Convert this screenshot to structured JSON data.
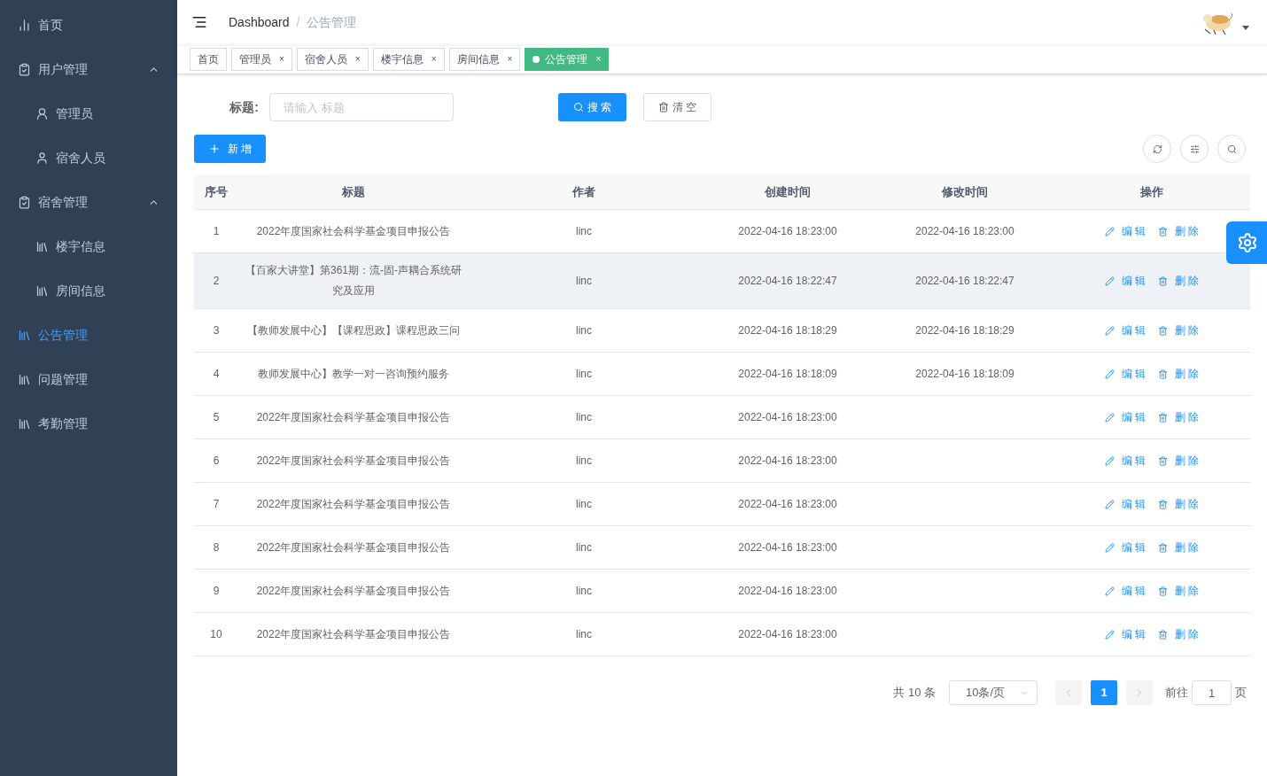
{
  "sidebar": {
    "items": [
      {
        "label": "首页",
        "kind": "chart",
        "selected": false
      },
      {
        "label": "用户管理",
        "kind": "clipboard",
        "selected": false,
        "expanded": true,
        "children": [
          {
            "label": "管理员",
            "kind": "user",
            "selected": false
          },
          {
            "label": "宿舍人员",
            "kind": "person",
            "selected": false
          }
        ]
      },
      {
        "label": "宿舍管理",
        "kind": "clipboard",
        "selected": false,
        "expanded": true,
        "children": [
          {
            "label": "楼宇信息",
            "kind": "book",
            "selected": false
          },
          {
            "label": "房间信息",
            "kind": "book",
            "selected": false
          }
        ]
      },
      {
        "label": "公告管理",
        "kind": "book",
        "selected": true
      },
      {
        "label": "问题管理",
        "kind": "book",
        "selected": false
      },
      {
        "label": "考勤管理",
        "kind": "book",
        "selected": false
      }
    ]
  },
  "breadcrumb": [
    "Dashboard",
    "公告管理"
  ],
  "breadcrumb_separator": "/",
  "tags": [
    {
      "label": "首页",
      "selected": false,
      "closable": false
    },
    {
      "label": "管理员",
      "selected": false,
      "closable": true
    },
    {
      "label": "宿舍人员",
      "selected": false,
      "closable": true
    },
    {
      "label": "楼宇信息",
      "selected": false,
      "closable": true
    },
    {
      "label": "房间信息",
      "selected": false,
      "closable": true
    },
    {
      "label": "公告管理",
      "selected": true,
      "closable": true
    }
  ],
  "tag_close": "×",
  "search": {
    "label": "标题:",
    "placeholder": "请输入 标题",
    "search_button": "搜 索",
    "clear_button": "清 空"
  },
  "add_button": "新 增",
  "table": {
    "columns": [
      "序号",
      "标题",
      "作者",
      "创建时间",
      "修改时间",
      "操作"
    ],
    "rows": [
      {
        "cells": [
          "1",
          "2022年度国家社会科学基金项目申报公告",
          "linc",
          "2022-04-16 18:23:00",
          "2022-04-16 18:23:00"
        ],
        "edit": "编 辑",
        "delete": "删 除",
        "highlighted": false
      },
      {
        "cells": [
          "2",
          "【百家大讲堂】第361期：流-固-声耦合系统研究及应用",
          "linc",
          "2022-04-16 18:22:47",
          "2022-04-16 18:22:47"
        ],
        "edit": "编 辑",
        "delete": "删 除",
        "highlighted": true
      },
      {
        "cells": [
          "3",
          "【教师发展中心】【课程思政】课程思政三问",
          "linc",
          "2022-04-16 18:18:29",
          "2022-04-16 18:18:29"
        ],
        "edit": "编 辑",
        "delete": "删 除",
        "highlighted": false
      },
      {
        "cells": [
          "4",
          "教师发展中心】教学一对一咨询预约服务",
          "linc",
          "2022-04-16 18:18:09",
          "2022-04-16 18:18:09"
        ],
        "edit": "编 辑",
        "delete": "删 除",
        "highlighted": false
      },
      {
        "cells": [
          "5",
          "2022年度国家社会科学基金项目申报公告",
          "linc",
          "2022-04-16 18:23:00",
          ""
        ],
        "edit": "编 辑",
        "delete": "删 除",
        "highlighted": false
      },
      {
        "cells": [
          "6",
          "2022年度国家社会科学基金项目申报公告",
          "linc",
          "2022-04-16 18:23:00",
          ""
        ],
        "edit": "编 辑",
        "delete": "删 除",
        "highlighted": false
      },
      {
        "cells": [
          "7",
          "2022年度国家社会科学基金项目申报公告",
          "linc",
          "2022-04-16 18:23:00",
          ""
        ],
        "edit": "编 辑",
        "delete": "删 除",
        "highlighted": false
      },
      {
        "cells": [
          "8",
          "2022年度国家社会科学基金项目申报公告",
          "linc",
          "2022-04-16 18:23:00",
          ""
        ],
        "edit": "编 辑",
        "delete": "删 除",
        "highlighted": false
      },
      {
        "cells": [
          "9",
          "2022年度国家社会科学基金项目申报公告",
          "linc",
          "2022-04-16 18:23:00",
          ""
        ],
        "edit": "编 辑",
        "delete": "删 除",
        "highlighted": false
      },
      {
        "cells": [
          "10",
          "2022年度国家社会科学基金项目申报公告",
          "linc",
          "2022-04-16 18:23:00",
          ""
        ],
        "edit": "编 辑",
        "delete": "删 除",
        "highlighted": false
      }
    ]
  },
  "pagination": {
    "total": "共 10 条",
    "page_size": "10条/页",
    "pages": [
      {
        "label": "1",
        "selected": true
      }
    ],
    "goto": "前往",
    "goto_value": "1",
    "page_unit": "页"
  }
}
